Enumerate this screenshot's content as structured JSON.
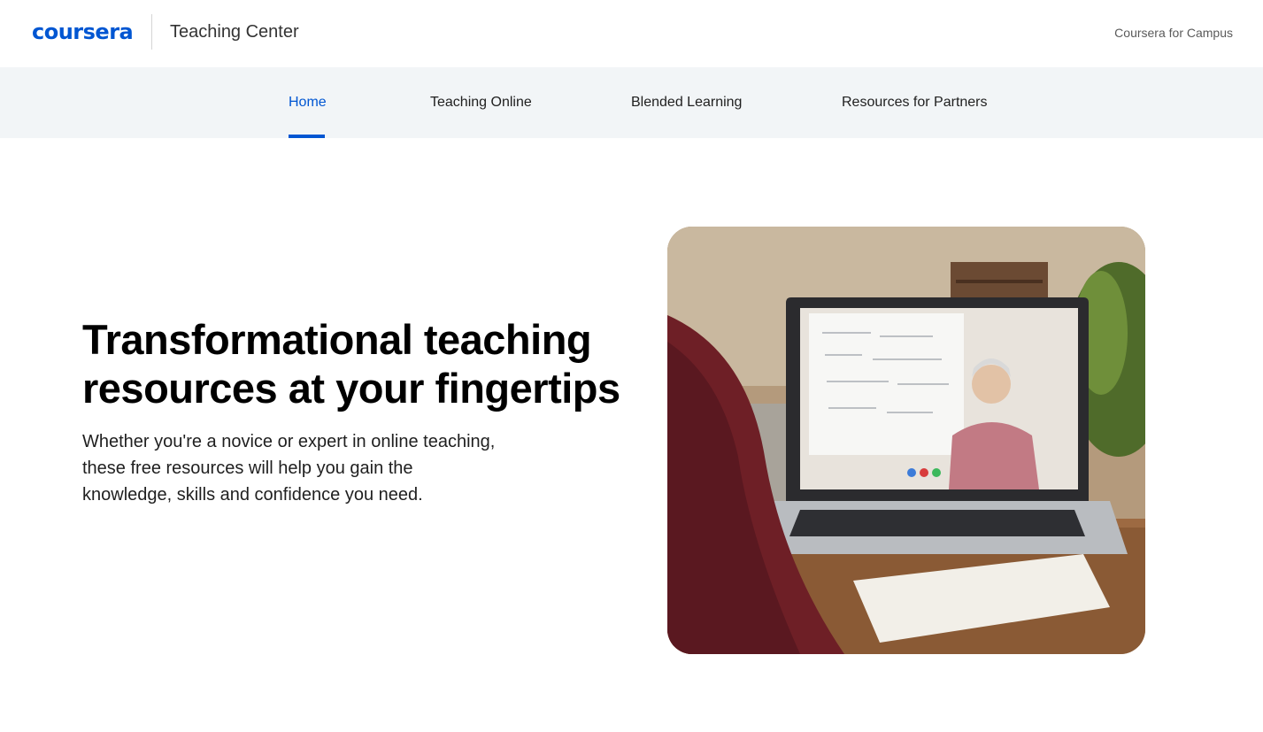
{
  "header": {
    "logo_text": "coursera",
    "site_name": "Teaching Center",
    "campus_link": "Coursera for Campus"
  },
  "nav": {
    "items": [
      {
        "label": "Home",
        "active": true
      },
      {
        "label": "Teaching Online",
        "active": false
      },
      {
        "label": "Blended Learning",
        "active": false
      },
      {
        "label": "Resources for Partners",
        "active": false
      }
    ]
  },
  "hero": {
    "title": "Transformational teaching resources at your fingertips",
    "subtitle": "Whether you're a novice or expert in online teaching, these free resources will help you gain the knowledge, skills and confidence you need."
  },
  "colors": {
    "brand": "#0056d2",
    "nav_bg": "#f2f5f7",
    "text": "#1f1f1f"
  }
}
